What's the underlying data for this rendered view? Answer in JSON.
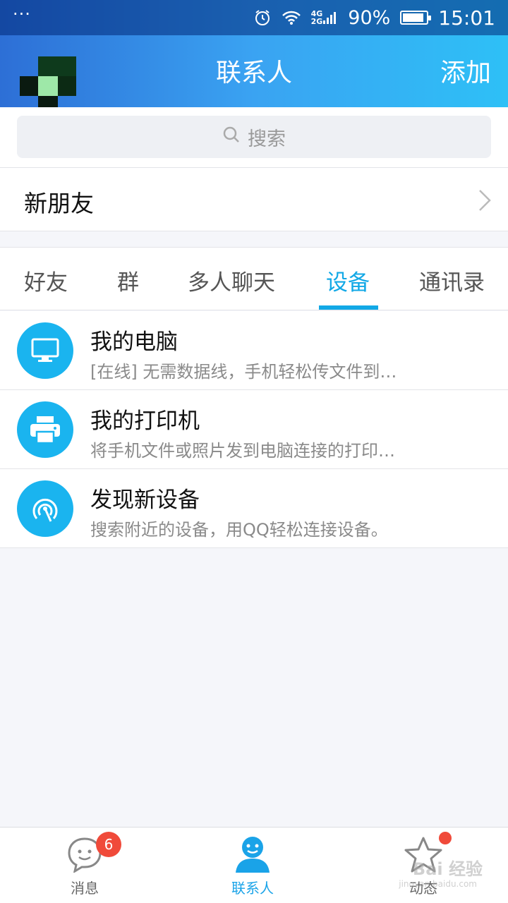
{
  "status_bar": {
    "dots": "···",
    "network": [
      "4G",
      "2G"
    ],
    "battery": "90%",
    "battery_level": 0.9,
    "time": "15:01"
  },
  "header": {
    "title": "联系人",
    "add_label": "添加"
  },
  "search": {
    "placeholder": "搜索"
  },
  "new_friends": {
    "label": "新朋友"
  },
  "tabs": [
    {
      "label": "好友",
      "active": false
    },
    {
      "label": "群",
      "active": false
    },
    {
      "label": "多人聊天",
      "active": false
    },
    {
      "label": "设备",
      "active": true
    },
    {
      "label": "通讯录",
      "active": false
    }
  ],
  "devices": [
    {
      "title": "我的电脑",
      "subtitle": "[在线] 无需数据线，手机轻松传文件到…",
      "icon": "monitor-icon"
    },
    {
      "title": "我的打印机",
      "subtitle": "将手机文件或照片发到电脑连接的打印…",
      "icon": "printer-icon"
    },
    {
      "title": "发现新设备",
      "subtitle": "搜索附近的设备，用QQ轻松连接设备。",
      "icon": "radar-icon"
    }
  ],
  "bottom_nav": [
    {
      "label": "消息",
      "badge": "6",
      "active": false
    },
    {
      "label": "联系人",
      "active": true
    },
    {
      "label": "动态",
      "dot": true,
      "active": false
    }
  ],
  "watermark": {
    "main": "Bai 经验",
    "sub": "jingyan.baidu.com"
  },
  "colors": {
    "accent": "#12a8e6",
    "badge": "#f04a3a",
    "icon_bg": "#1ab4ef"
  }
}
